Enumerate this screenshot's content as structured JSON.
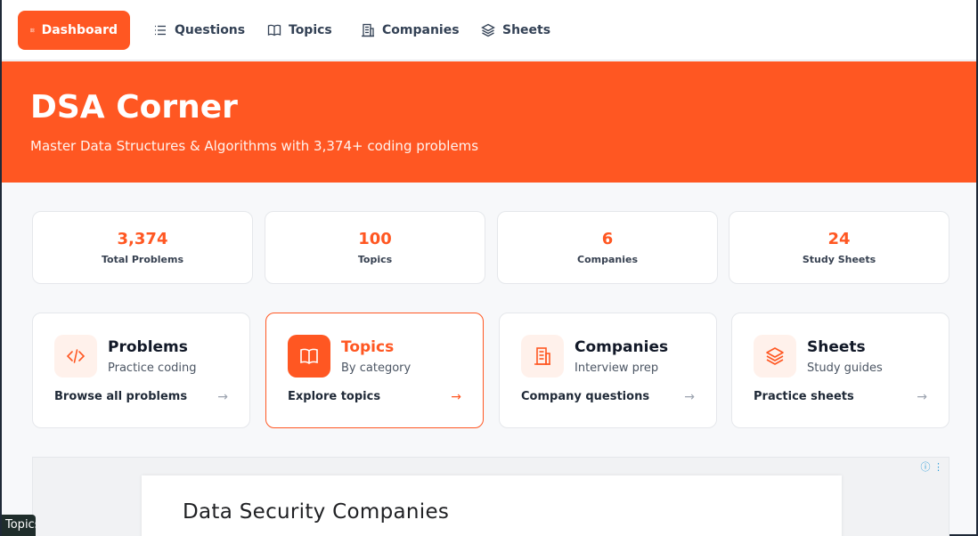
{
  "nav": {
    "items": [
      {
        "label": "Dashboard",
        "icon": "dashboard-icon",
        "active": true
      },
      {
        "label": "Questions",
        "icon": "list-icon"
      },
      {
        "label": "Topics",
        "icon": "book-icon"
      },
      {
        "label": "Companies",
        "icon": "building-icon"
      },
      {
        "label": "Sheets",
        "icon": "layers-icon"
      }
    ]
  },
  "hero": {
    "title": "DSA Corner",
    "subtitle": "Master Data Structures & Algorithms with 3,374+ coding problems"
  },
  "stats": [
    {
      "value": "3,374",
      "label": "Total Problems"
    },
    {
      "value": "100",
      "label": "Topics"
    },
    {
      "value": "6",
      "label": "Companies"
    },
    {
      "value": "24",
      "label": "Study Sheets"
    }
  ],
  "cards": [
    {
      "title": "Problems",
      "subtitle": "Practice coding",
      "link": "Browse all problems",
      "icon": "code-icon"
    },
    {
      "title": "Topics",
      "subtitle": "By category",
      "link": "Explore topics",
      "icon": "book-icon"
    },
    {
      "title": "Companies",
      "subtitle": "Interview prep",
      "link": "Company questions",
      "icon": "building-icon"
    },
    {
      "title": "Sheets",
      "subtitle": "Study guides",
      "link": "Practice sheets",
      "icon": "layers-icon"
    }
  ],
  "ad": {
    "title": "Data Security Companies",
    "info_icons": "ⓘ ⋮"
  },
  "tooltip": {
    "text": "Topics"
  },
  "colors": {
    "accent": "#ff5722",
    "accent_light": "#fff1eb"
  }
}
